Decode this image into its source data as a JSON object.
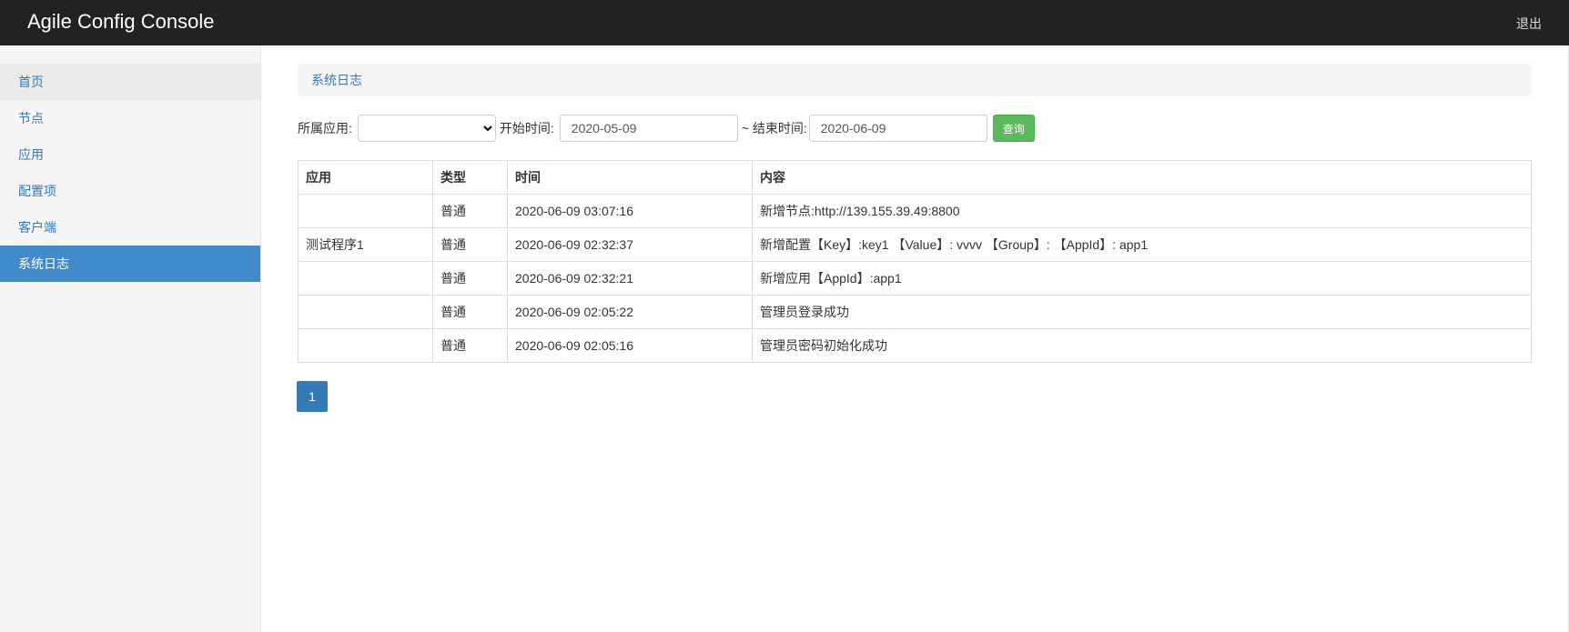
{
  "header": {
    "brand": "Agile Config Console",
    "logout": "退出"
  },
  "sidebar": {
    "items": [
      {
        "label": "首页"
      },
      {
        "label": "节点"
      },
      {
        "label": "应用"
      },
      {
        "label": "配置项"
      },
      {
        "label": "客户端"
      },
      {
        "label": "系统日志"
      }
    ],
    "active_index": 5
  },
  "breadcrumb": "系统日志",
  "filters": {
    "app_label": "所属应用:",
    "app_selected": "",
    "start_label": "开始时间:",
    "start_value": "2020-05-09",
    "end_label": "~ 结束时间:",
    "end_value": "2020-06-09",
    "search_button": "查询"
  },
  "table": {
    "columns": [
      "应用",
      "类型",
      "时间",
      "内容"
    ],
    "rows": [
      {
        "app": "",
        "type": "普通",
        "time": "2020-06-09 03:07:16",
        "content": "新增节点:http://139.155.39.49:8800"
      },
      {
        "app": "测试程序1",
        "type": "普通",
        "time": "2020-06-09 02:32:37",
        "content": "新增配置【Key】:key1 【Value】: vvvv 【Group】: 【AppId】: app1"
      },
      {
        "app": "",
        "type": "普通",
        "time": "2020-06-09 02:32:21",
        "content": "新增应用【AppId】:app1"
      },
      {
        "app": "",
        "type": "普通",
        "time": "2020-06-09 02:05:22",
        "content": "管理员登录成功"
      },
      {
        "app": "",
        "type": "普通",
        "time": "2020-06-09 02:05:16",
        "content": "管理员密码初始化成功"
      }
    ]
  },
  "pagination": {
    "current": "1"
  },
  "colors": {
    "topbar": "#222222",
    "accent": "#428bca",
    "link": "#337ab7",
    "success": "#5cb85c"
  }
}
